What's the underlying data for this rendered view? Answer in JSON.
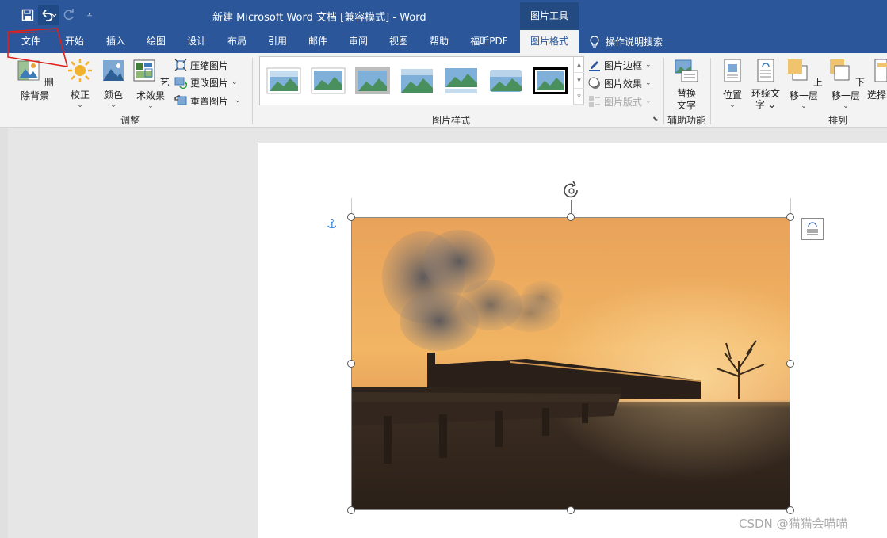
{
  "titlebar": {
    "title": "新建 Microsoft Word 文档 [兼容模式]  -  Word",
    "context_tab": "图片工具",
    "qat_more": "⩡"
  },
  "tabs": [
    {
      "label": "文件"
    },
    {
      "label": "开始"
    },
    {
      "label": "插入"
    },
    {
      "label": "绘图"
    },
    {
      "label": "设计"
    },
    {
      "label": "布局"
    },
    {
      "label": "引用"
    },
    {
      "label": "邮件"
    },
    {
      "label": "审阅"
    },
    {
      "label": "视图"
    },
    {
      "label": "帮助"
    },
    {
      "label": "福昕PDF"
    },
    {
      "label": "图片格式"
    }
  ],
  "tell_me": "操作说明搜索",
  "ribbon": {
    "adjust": {
      "remove_bg": "删除背景",
      "correct": "校正",
      "color": "颜色",
      "artistic": "艺术效果",
      "compress": "压缩图片",
      "change": "更改图片",
      "reset": "重置图片",
      "label": "调整"
    },
    "styles": {
      "border": "图片边框",
      "effects": "图片效果",
      "layout": "图片版式",
      "label": "图片样式"
    },
    "accessibility": {
      "alt_text_1": "替换",
      "alt_text_2": "文字",
      "label": "辅助功能"
    },
    "arrange": {
      "position": "位置",
      "wrap_1": "环绕文",
      "wrap_2": "字",
      "forward": "上移一层",
      "backward": "下移一层",
      "select": "选择",
      "label": "排列"
    }
  },
  "watermark": "CSDN @猫猫会喵喵",
  "colors": {
    "title_bar": "#2b579a",
    "ribbon": "#f3f3f3",
    "annotation": "#e0201a"
  }
}
